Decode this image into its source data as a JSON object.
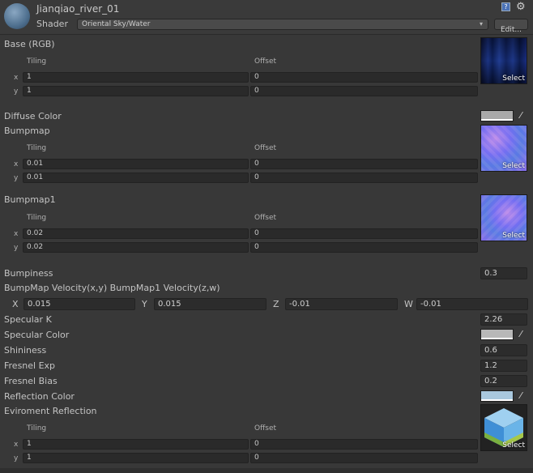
{
  "header": {
    "title": "Jianqiao_river_01",
    "shader_label": "Shader",
    "shader_value": "Oriental Sky/Water",
    "edit_label": "Edit..."
  },
  "labels": {
    "tiling": "Tiling",
    "offset": "Offset",
    "x": "x",
    "y": "y",
    "select": "Select"
  },
  "base": {
    "label": "Base (RGB)",
    "tiling_x": "1",
    "tiling_y": "1",
    "offset_x": "0",
    "offset_y": "0"
  },
  "diffuse": {
    "label": "Diffuse Color",
    "color": "#a9a9a9"
  },
  "bumpmap": {
    "label": "Bumpmap",
    "tiling_x": "0.01",
    "tiling_y": "0.01",
    "offset_x": "0",
    "offset_y": "0"
  },
  "bumpmap1": {
    "label": "Bumpmap1",
    "tiling_x": "0.02",
    "tiling_y": "0.02",
    "offset_x": "0",
    "offset_y": "0"
  },
  "bumpiness": {
    "label": "Bumpiness",
    "value": "0.3"
  },
  "velocity": {
    "label": "BumpMap Velocity(x,y) BumpMap1 Velocity(z,w)",
    "x_label": "X",
    "x": "0.015",
    "y_label": "Y",
    "y": "0.015",
    "z_label": "Z",
    "z": "-0.01",
    "w_label": "W",
    "w": "-0.01"
  },
  "specular_k": {
    "label": "Specular K",
    "value": "2.26"
  },
  "specular_color": {
    "label": "Specular Color",
    "color": "#b8b8b8"
  },
  "shininess": {
    "label": "Shininess",
    "value": "0.6"
  },
  "fresnel_exp": {
    "label": "Fresnel Exp",
    "value": "1.2"
  },
  "fresnel_bias": {
    "label": "Fresnel Bias",
    "value": "0.2"
  },
  "reflection_color": {
    "label": "Reflection Color",
    "color": "#a9c8de"
  },
  "env": {
    "label": "Eviroment Reflection",
    "tiling_x": "1",
    "tiling_y": "1",
    "offset_x": "0",
    "offset_y": "0"
  },
  "icons": [
    "material-sphere-icon",
    "help-icon",
    "gear-icon",
    "dropdown-arrow-icon",
    "eyedropper-icon"
  ]
}
